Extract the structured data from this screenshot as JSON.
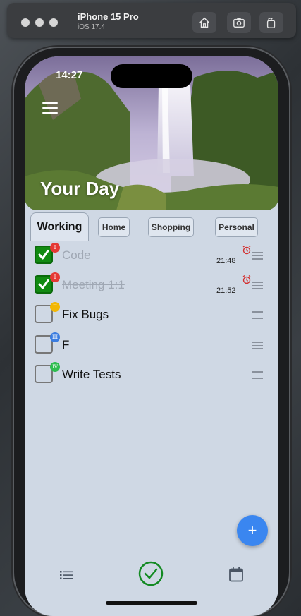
{
  "simulator": {
    "device_name": "iPhone 15 Pro",
    "os_version": "iOS 17.4",
    "buttons": [
      "home-icon",
      "screenshot-icon",
      "rotate-icon"
    ]
  },
  "status_bar": {
    "time": "14:27"
  },
  "header": {
    "title": "Your Day",
    "menu_icon": "hamburger-menu-icon"
  },
  "tabs": [
    {
      "label": "Working",
      "active": true
    },
    {
      "label": "Home",
      "active": false
    },
    {
      "label": "Shopping",
      "active": false
    },
    {
      "label": "Personal",
      "active": false
    }
  ],
  "tasks": [
    {
      "title": "Code",
      "done": true,
      "priority": "I",
      "priority_color": "#e53935",
      "alarm_time": "21:48"
    },
    {
      "title": "Meeting 1:1",
      "done": true,
      "priority": "I",
      "priority_color": "#e53935",
      "alarm_time": "21:52"
    },
    {
      "title": "Fix Bugs",
      "done": false,
      "priority": "II",
      "priority_color": "#f2b705",
      "alarm_time": ""
    },
    {
      "title": "F",
      "done": false,
      "priority": "III",
      "priority_color": "#3b7de0",
      "alarm_time": ""
    },
    {
      "title": "Write Tests",
      "done": false,
      "priority": "IV",
      "priority_color": "#2ebd4f",
      "alarm_time": ""
    }
  ],
  "fab": {
    "label": "+"
  },
  "bottom_nav": [
    {
      "icon": "list-icon",
      "active": false
    },
    {
      "icon": "check-circle-icon",
      "active": true
    },
    {
      "icon": "calendar-icon",
      "active": false
    }
  ],
  "colors": {
    "accent": "#3a86f0",
    "done_green": "#118a11",
    "background": "#cfd8e4"
  }
}
